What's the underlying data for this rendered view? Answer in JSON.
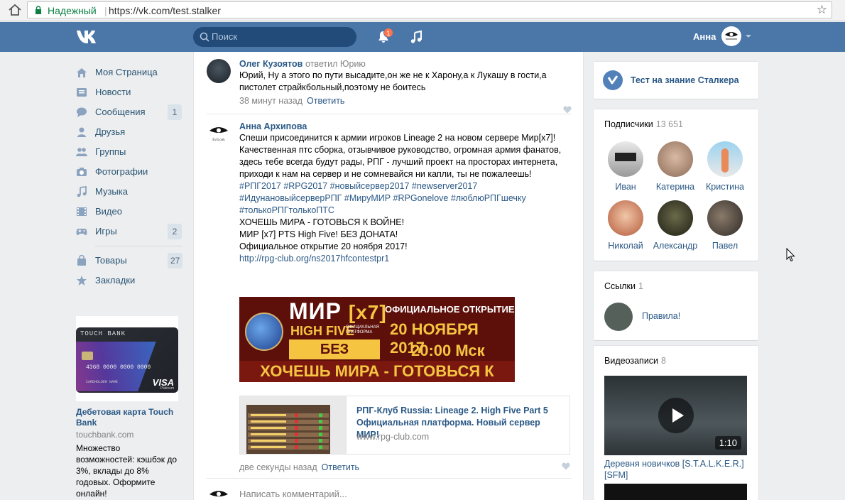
{
  "browser": {
    "secure_label": "Надежный",
    "url": "https://vk.com/test.stalker"
  },
  "header": {
    "search_placeholder": "Поиск",
    "notification_count": "1",
    "user_name": "Анна"
  },
  "sidebar": {
    "items": [
      {
        "label": "Моя Страница",
        "icon": "home-icon",
        "count": ""
      },
      {
        "label": "Новости",
        "icon": "news-icon",
        "count": ""
      },
      {
        "label": "Сообщения",
        "icon": "messages-icon",
        "count": "1"
      },
      {
        "label": "Друзья",
        "icon": "friends-icon",
        "count": ""
      },
      {
        "label": "Группы",
        "icon": "groups-icon",
        "count": ""
      },
      {
        "label": "Фотографии",
        "icon": "camera-icon",
        "count": ""
      },
      {
        "label": "Музыка",
        "icon": "music-icon",
        "count": ""
      },
      {
        "label": "Видео",
        "icon": "video-icon",
        "count": ""
      },
      {
        "label": "Игры",
        "icon": "gamepad-icon",
        "count": "2"
      }
    ],
    "items2": [
      {
        "label": "Товары",
        "icon": "bag-icon",
        "count": "27"
      },
      {
        "label": "Закладки",
        "icon": "star-icon",
        "count": ""
      }
    ],
    "ad": {
      "card_brand": "TOUCH BANK",
      "card_number": "4368 0000 0000 0000",
      "card_holder": "CARDHOLDER NAME",
      "card_visa": "VISA",
      "card_platinum": "Platinum",
      "title": "Дебетовая карта Touch Bank",
      "host": "touchbank.com",
      "text": "Множество возможностей: кэшбэк до 3%, вклады до 8% годовых. Оформите онлайн!"
    }
  },
  "feed": {
    "comment1": {
      "author": "Олег Кузоятов",
      "reply_to": "ответил Юрию",
      "text": "Юрий, Ну а этого по пути высадите,он же не к Харону,а к Лукашу в гости,а пистолет страйкбольный,поэтому не боитесь",
      "time": "38 минут назад",
      "reply_label": "Ответить"
    },
    "comment2": {
      "author": "Анна Архипова",
      "lines": [
        "Спеши присоединится к армии игроков Lineage 2 на новом сервере Мир[x7]! Качественная птс сборка, отзывчивое руководство, огромная армия фанатов,",
        "здесь тебе всегда будут рады, РПГ - лучший проект на просторах интернета, приходи к нам на сервер и не сомневайся ни капли, ты не пожалеешь!"
      ],
      "hashtags": "#РПГ2017 #RPG2017 #новыйсервер2017 #newserver2017 #ИдунановыйсерверРПГ #МируМИР #RPGonelove #люблюРПГшечку #толькоРПГтолькоПТС",
      "line_war": "ХОЧЕШЬ МИРА - ГОТОВЬСЯ К ВОЙНЕ!",
      "line_pts": "МИР [x7] PTS High Five! БЕЗ ДОНАТА!",
      "line_open": "Официальное открытие 20 ноября 2017!",
      "link": "http://rpg-club.org/ns2017hfcontestpr1",
      "banner": {
        "mir": "МИР",
        "x7": "[x7]",
        "high_five": "HIGH FIVE",
        "official_platform": "ОФИЦИАЛЬНАЯ ПЛАТФОРМА",
        "no_donate": "БЕЗ ДОНАТА",
        "opening": "ОФИЦИАЛЬНОЕ ОТКРЫТИЕ",
        "date": "20 НОЯБРЯ 2017",
        "time": "20:00 Мск",
        "slogan": "ХОЧЕШЬ МИРА - ГОТОВЬСЯ К ВОЙНЕ"
      },
      "snippet": {
        "title": "РПГ-Клуб Russia: Lineage 2. High Five Part 5 Официальная платформа. Новый сервер МИР!",
        "host": "www.rpg-club.com"
      },
      "time": "две секунды назад",
      "reply_label": "Ответить"
    },
    "write_placeholder": "Написать комментарий..."
  },
  "right": {
    "test_label": "Тест на знание Сталкера",
    "subscribers": {
      "title": "Подписчики",
      "count": "13 651",
      "people": [
        "Иван",
        "Катерина",
        "Кристина",
        "Николай",
        "Александр",
        "Павел"
      ]
    },
    "links": {
      "title": "Ссылки",
      "count": "1",
      "item": "Правила!"
    },
    "videos": {
      "title": "Видеозаписи",
      "count": "8",
      "duration": "1:10",
      "item_title": "Деревня новичков [S.T.A.L.K.E.R.] [SFM]"
    }
  },
  "colors": {
    "header_blue": "#4a76a8",
    "link_blue": "#2a5885",
    "secure_green": "#0b8043"
  }
}
